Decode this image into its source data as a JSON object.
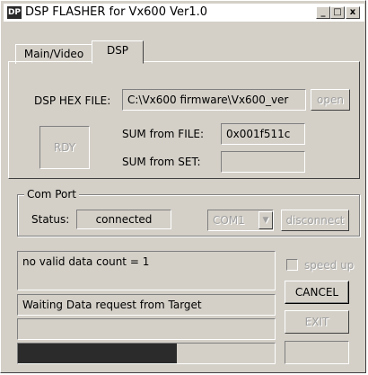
{
  "window": {
    "title": "DSP FLASHER for Vx600  Ver1.0",
    "icon": "DP"
  },
  "title_buttons": {
    "minimize": "_",
    "maximize": "□",
    "close": "x"
  },
  "tabs": [
    {
      "label": "Main/Video"
    },
    {
      "label": "DSP"
    }
  ],
  "dsp": {
    "hex_file_label": "DSP HEX FILE:",
    "hex_file_value": "C:\\Vx600 firmware\\Vx600_ver",
    "open_label": "open",
    "rdy_label": "RDY",
    "sum_file_label": "SUM from FILE:",
    "sum_file_value": "0x001f511c",
    "sum_set_label": "SUM from SET:",
    "sum_set_value": ""
  },
  "com_port": {
    "group_label": "Com Port",
    "status_label": "Status:",
    "status_value": "connected",
    "port_value": "COM1",
    "dropdown_arrow": "▼",
    "disconnect_label": "disconnect"
  },
  "log": {
    "message1": "no valid data count = 1",
    "message2": "Waiting Data request from Target",
    "message3": ""
  },
  "controls": {
    "speed_up_label": "speed up",
    "speed_up_checked": false,
    "cancel_label": "CANCEL",
    "exit_label": "EXIT",
    "small_box_value": ""
  },
  "progress": {
    "fraction": 0.62
  }
}
